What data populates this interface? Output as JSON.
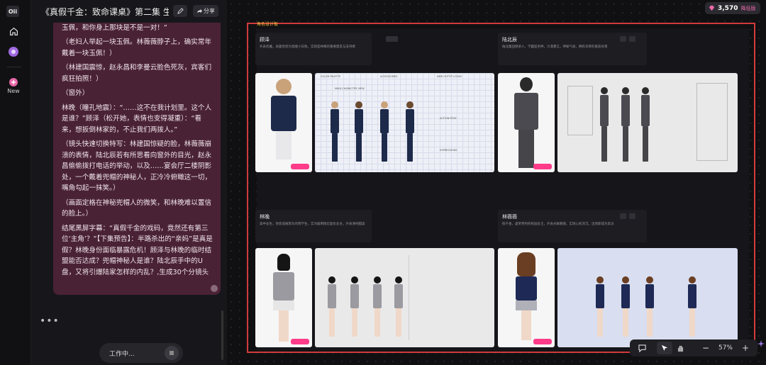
{
  "sidebar": {
    "logo_text": "Oii",
    "new_label": "New"
  },
  "chat": {
    "title": "《真假千金：致命课桌》第二集 生...",
    "share_label": "分享",
    "paragraphs": [
      "是你亲妈啊！当年医院抱错了！我有证据！你看这玉佩，和你身上那块是不是一对！”",
      "（老妇人举起一块玉佩。林薇薇脖子上，确实常年戴着一块玉佩！）",
      "（林建国震惊，赵永昌和李曼云脸色死灰，宾客们疯狂拍照！）",
      "（窗外）",
      "林晚（瞳孔地震）：“……这不在我计划里。这个人是谁？”顾泽（松开她，表情也变得凝重）：“看来，想扳倒林家的，不止我们两拨人。”",
      "（镜头快速切换特写：林建国惊疑的脸，林薇薇崩溃的表情，陆北辰若有所思看向窗外的目光，赵永昌偷偷拨打电话的举动，以及……宴会厅二楼阴影处，一个戴着兜帽的神秘人，正冷冷俯瞰这一切，嘴角勾起一抹笑。）",
      "（画面定格在神秘兜帽人的微笑，和林晚难以置信的脸上。）",
      "结尾黑屏字幕：“真假千金的戏码，竟然还有第三位‘主角’？”【下集预告】：半路杀出的“亲妈”是真是假？林晚身份面临暴露危机！顾泽与林晚的临时结盟能否达成？兜帽神秘人是谁？陆北辰手中的U盘，又将引爆陆家怎样的内乱？,生成30个分镜头"
    ],
    "dots": "•••",
    "working_label": "工作中..."
  },
  "header": {
    "credits": "3,570",
    "version_label": "降低版"
  },
  "board": {
    "frame_label": "角色设计板",
    "characters": [
      {
        "name": "顾泽",
        "desc": "外表优雅，表面伪装为温顺小白兔，实则是林晚的重要盟友与支持者"
      },
      {
        "name": "陆北辰",
        "desc": "陆北集团继承人，学霸型男神，冷漠寡言，神秘气质，拥有深厚的家族背景"
      },
      {
        "name": "林晚",
        "desc": "高中女生，伪装成被欺负的转学生，实为聪明隐忍复仇女主，外表清纯甜美"
      },
      {
        "name": "林薇薇",
        "desc": "假千金，虚荣势利的校园女王，外表光鲜靓丽，实则心机深沉，出场即成为反派"
      }
    ],
    "tile_badge": "已生成",
    "sheet_labels": {
      "palette": "COLOR PALETTE",
      "accessories": "ACCESSORIES",
      "outfits": "NEW OUTFIT LOOKS",
      "reference": "MAIN CHARACTER VIEW",
      "action": "ACTION POSE",
      "expression": "EXPRESSIONS"
    }
  },
  "toolbar": {
    "zoom": "57%",
    "minus": "−",
    "plus": "+"
  },
  "colors": {
    "frame_border": "#d23a3a",
    "chat_bubble": "#4a2235",
    "accent": "#ff3c8a"
  }
}
